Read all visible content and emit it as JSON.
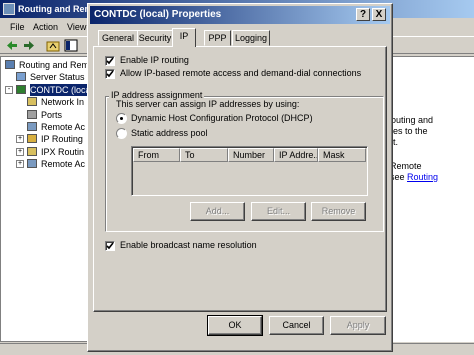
{
  "background_window": {
    "title": "Routing and Remo",
    "menu": [
      "File",
      "Action",
      "View"
    ],
    "tree": [
      {
        "label": "Routing and Remo",
        "indent": 0,
        "expander": ""
      },
      {
        "label": "Server Status",
        "indent": 1,
        "expander": ""
      },
      {
        "label": "CONTDC (local)",
        "indent": 1,
        "expander": "-"
      },
      {
        "label": "Network In",
        "indent": 2,
        "expander": ""
      },
      {
        "label": "Ports",
        "indent": 2,
        "expander": ""
      },
      {
        "label": "Remote Ac",
        "indent": 2,
        "expander": ""
      },
      {
        "label": "IP Routing",
        "indent": 2,
        "expander": "+"
      },
      {
        "label": "IPX Routin",
        "indent": 2,
        "expander": "+"
      },
      {
        "label": "Remote Ac",
        "indent": 2,
        "expander": "+"
      }
    ],
    "right_pane": {
      "line1": "routing and",
      "line2": "ges to the",
      "line3": "et.",
      "line4": "Remote",
      "line5_prefix": "see ",
      "link": "Routing"
    }
  },
  "dialog": {
    "title": "CONTDC (local) Properties",
    "help_button": "?",
    "close_button": "X",
    "tabs": [
      "General",
      "Security",
      "IP",
      "PPP",
      "Logging"
    ],
    "active_tab": "IP",
    "enable_ip_routing": {
      "label": "Enable IP routing",
      "checked": true
    },
    "allow_ip_access": {
      "label": "Allow IP-based remote access and demand-dial connections",
      "checked": true
    },
    "ip_assignment": {
      "group_label": "IP address assignment",
      "description": "This server can assign IP addresses by using:",
      "dhcp_label": "Dynamic Host Configuration Protocol (DHCP)",
      "static_label": "Static address pool",
      "selected": "dhcp",
      "columns": [
        "From",
        "To",
        "Number",
        "IP Addre...",
        "Mask"
      ],
      "add_button": "Add...",
      "edit_button": "Edit...",
      "remove_button": "Remove"
    },
    "broadcast": {
      "label": "Enable broadcast name resolution",
      "checked": true
    },
    "ok_button": "OK",
    "cancel_button": "Cancel",
    "apply_button": "Apply"
  }
}
